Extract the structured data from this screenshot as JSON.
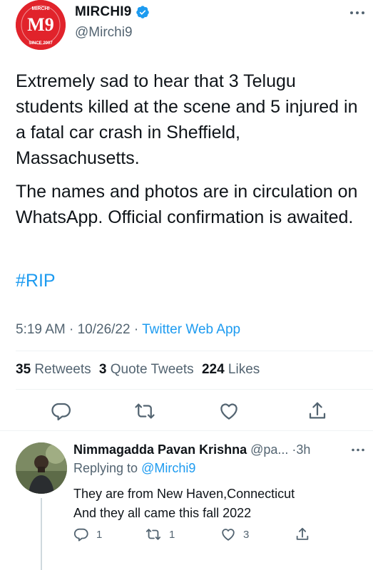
{
  "tweet": {
    "author_name": "MIRCHI9",
    "author_handle": "@Mirchi9",
    "avatar_text": "M9",
    "avatar_top_text": "MIRCHI",
    "avatar_bottom_text": "SINCE 2007",
    "body_paragraphs": [
      "Extremely sad to hear that 3 Telugu students killed at the scene and 5 injured in a fatal car crash in Sheffield, Massachusetts.",
      "The names and photos are in circulation on WhatsApp. Official confirmation is awaited."
    ],
    "hashtag": "#RIP",
    "time": "5:19 AM",
    "date": "10/26/22",
    "separator": "·",
    "source": "Twitter Web App",
    "stats": {
      "retweets_count": "35",
      "retweets_label": "Retweets",
      "quote_count": "3",
      "quote_label": "Quote Tweets",
      "likes_count": "224",
      "likes_label": "Likes"
    },
    "icons": {
      "reply": "reply-icon",
      "retweet": "retweet-icon",
      "like": "heart-icon",
      "share": "share-icon",
      "more": "more-icon",
      "verified": "verified-badge-icon"
    }
  },
  "reply": {
    "name": "Nimmagadda Pavan Krishna",
    "handle": "@pa...",
    "separator": "·",
    "time": "3h",
    "replying_to_label": "Replying to",
    "replying_to_mention": "@Mirchi9",
    "text_lines": [
      "They are from New Haven,Connecticut",
      "And they all came this fall 2022"
    ],
    "reply_count": "1",
    "retweet_count": "1",
    "like_count": "3"
  },
  "colors": {
    "brand_red": "#e1232b",
    "link_blue": "#1d9bf0",
    "secondary_text": "#536471",
    "primary_text": "#0f1419",
    "divider": "#eff3f4"
  }
}
